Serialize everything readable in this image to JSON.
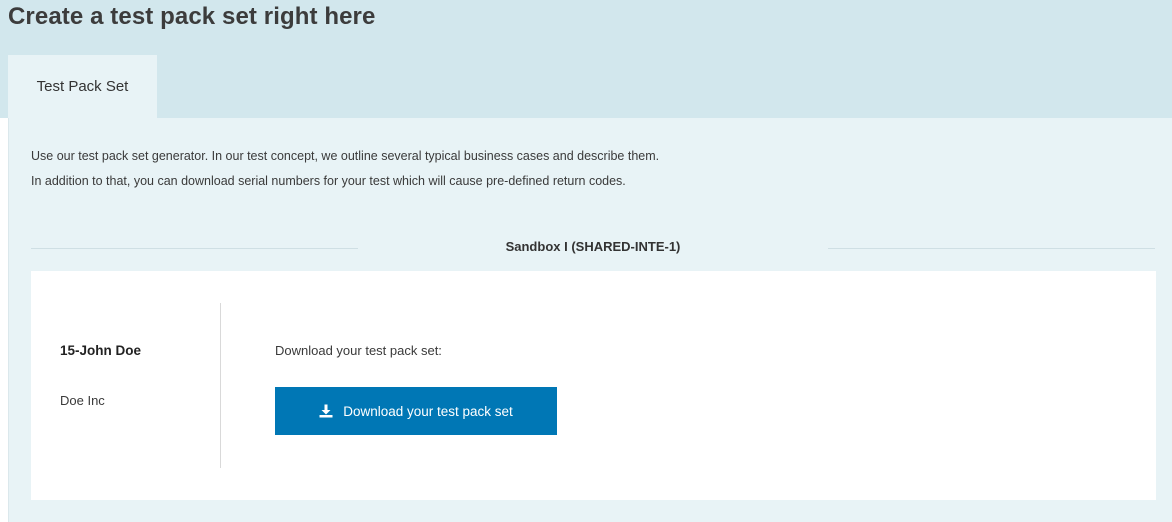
{
  "page": {
    "title": "Create a test pack set right here"
  },
  "tabs": [
    {
      "label": "Test Pack Set",
      "active": true
    }
  ],
  "intro": {
    "line1": "Use our test pack set generator. In our test concept, we outline several typical business cases and describe them.",
    "line2": "In addition to that, you can download serial numbers for your test which will cause pre-defined return codes."
  },
  "sandbox": {
    "title": "Sandbox I (SHARED-INTE-1)"
  },
  "customer": {
    "name": "15-John Doe",
    "company": "Doe Inc"
  },
  "download": {
    "label": "Download your test pack set:",
    "button_label": "Download your test pack set",
    "button_icon": "download-icon"
  },
  "colors": {
    "header_band": "#d2e7ed",
    "panel": "#e8f3f6",
    "button": "#0077b5"
  }
}
